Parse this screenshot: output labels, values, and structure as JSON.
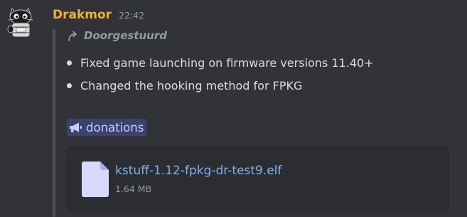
{
  "message": {
    "author": "Drakmor",
    "timestamp": "22:42",
    "author_color": "#f0b232",
    "forwarded_label": "Doorgestuurd",
    "bullets": [
      "Fixed game launching on firmware versions 11.40+",
      "Changed the hooking method for FPKG"
    ],
    "channel_mention": {
      "icon": "megaphone-icon",
      "label": "donations"
    },
    "attachment": {
      "icon": "file-icon",
      "filename": "kstuff-1.12-fpkg-dr-test9.elf",
      "size": "1.64 MB",
      "link_color": "#7eb0ec"
    }
  }
}
